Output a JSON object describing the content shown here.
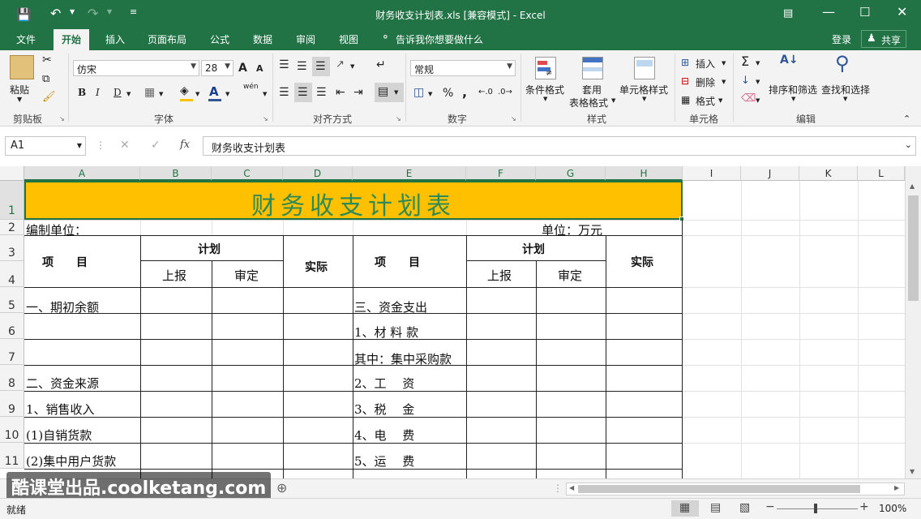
{
  "titlebar": {
    "title": "财务收支计划表.xls  [兼容模式] - Excel"
  },
  "tabs": [
    "文件",
    "开始",
    "插入",
    "页面布局",
    "公式",
    "数据",
    "审阅",
    "视图"
  ],
  "tell_me": "告诉我你想要做什么",
  "login": "登录",
  "share": "共享",
  "ribbon": {
    "clipboard": {
      "paste": "粘贴",
      "label": "剪贴板"
    },
    "font": {
      "name": "仿宋",
      "size": "28",
      "label": "字体",
      "bold": "B",
      "italic": "I",
      "underline": "D",
      "grow": "A",
      "shrink": "A",
      "wen": "wén"
    },
    "align": {
      "label": "对齐方式"
    },
    "number": {
      "format": "常规",
      "label": "数字",
      "percent": "%",
      "comma": ","
    },
    "styles": {
      "cond": "条件格式",
      "table1": "套用",
      "table2": "表格格式",
      "cell": "单元格样式",
      "label": "样式"
    },
    "cells": {
      "insert": "插入",
      "delete": "删除",
      "format": "格式",
      "label": "单元格"
    },
    "editing": {
      "sort": "排序和筛选",
      "find": "查找和选择",
      "label": "编辑"
    }
  },
  "formula": {
    "namebox": "A1",
    "fx": "fx",
    "content": "财务收支计划表"
  },
  "columns": [
    "A",
    "B",
    "C",
    "D",
    "E",
    "F",
    "G",
    "H",
    "I",
    "J",
    "K",
    "L"
  ],
  "rows": [
    "1",
    "2",
    "3",
    "4",
    "5",
    "6",
    "7",
    "8",
    "9",
    "10",
    "11"
  ],
  "cells": {
    "title": "财务收支计划表",
    "unit_left": "编制单位：",
    "unit_right": "单位：万元",
    "item_left": "项　　目",
    "plan_left": "计划",
    "report_left": "上报",
    "approve_left": "审定",
    "actual_left": "实际",
    "item_right": "项　　目",
    "plan_right": "计划",
    "report_right": "上报",
    "approve_right": "审定",
    "actual_right": "实际",
    "a5": "一、期初余额",
    "e5": "三、资金支出",
    "e6": "1、材 料 款",
    "e7": "其中：集中采购款",
    "a8": "二、资金来源",
    "e8": "2、工　 资",
    "a9": "1、销售收入",
    "e9": "3、税　 金",
    "a10": "(1)自销货款",
    "e10": "4、电　 费",
    "a11": "(2)集中用户货款",
    "e11": "5、运　 费"
  },
  "watermark": "酷课堂出品.coolketang.com",
  "status": {
    "ready": "就绪",
    "zoom": "100%"
  },
  "colors": {
    "excel_green": "#217346",
    "title_fill": "#FFC000",
    "title_text": "#2E8B57"
  }
}
